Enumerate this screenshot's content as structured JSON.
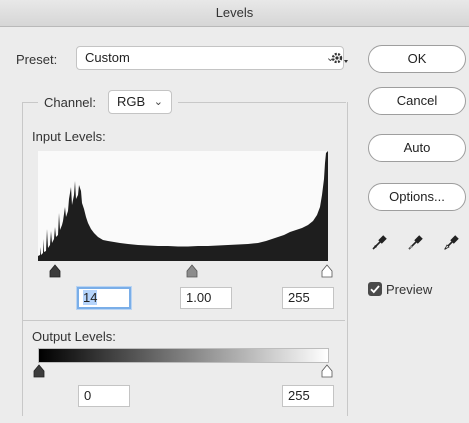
{
  "window": {
    "title": "Levels"
  },
  "preset": {
    "label": "Preset:",
    "value": "Custom"
  },
  "channel": {
    "label": "Channel:",
    "value": "RGB"
  },
  "input_levels": {
    "label": "Input Levels:",
    "black": "14",
    "gamma": "1.00",
    "white": "255"
  },
  "output_levels": {
    "label": "Output Levels:",
    "black": "0",
    "white": "255"
  },
  "buttons": {
    "ok": "OK",
    "cancel": "Cancel",
    "auto": "Auto",
    "options": "Options..."
  },
  "preview": {
    "label": "Preview",
    "checked": true
  },
  "icons": {
    "gear": "gear-icon",
    "eyedroppers": [
      "black-point-eyedropper-icon",
      "gray-point-eyedropper-icon",
      "white-point-eyedropper-icon"
    ]
  },
  "colors": {
    "focus": "#7aaee8",
    "selection": "#b5d4fb",
    "checkbox": "#4a4a4a"
  }
}
